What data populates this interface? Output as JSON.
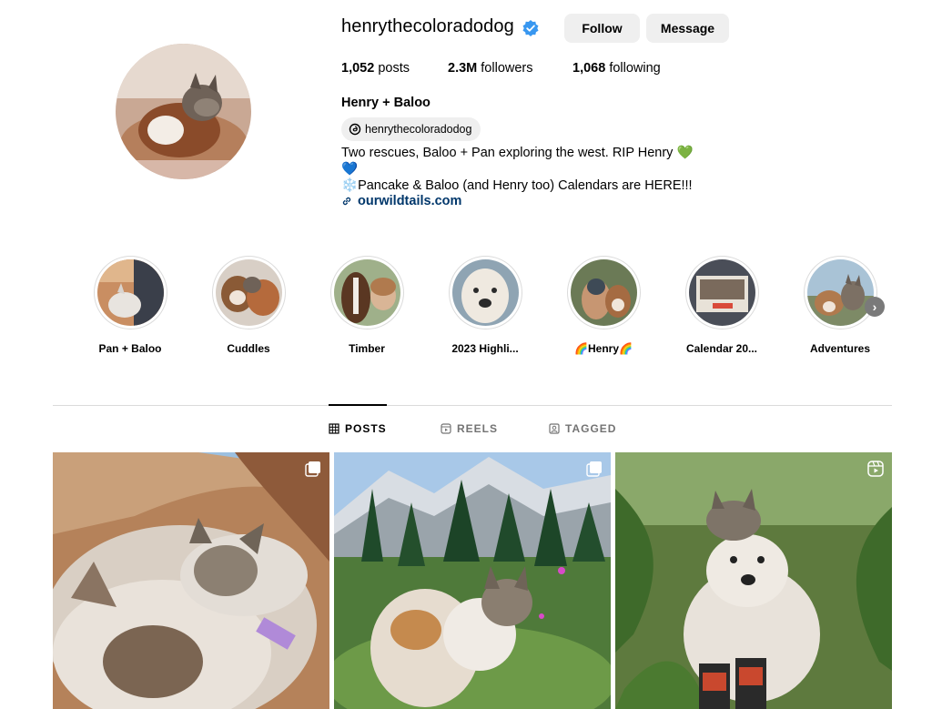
{
  "profile": {
    "username": "henrythecoloradodog",
    "verified": true,
    "follow_label": "Follow",
    "message_label": "Message",
    "stats": {
      "posts_count": "1,052",
      "posts_label": "posts",
      "followers_count": "2.3M",
      "followers_label": "followers",
      "following_count": "1,068",
      "following_label": "following"
    },
    "display_name": "Henry + Baloo",
    "threads_handle": "henrythecoloradodog",
    "bio": {
      "line1": "Two rescues, Baloo + Pan exploring the west. RIP Henry",
      "line1_emoji": "💚",
      "line2_emoji": "💙",
      "line3_emoji": "❄️",
      "line3": "Pancake & Baloo (and Henry too) Calendars are HERE!!!"
    },
    "link": "ourwildtails.com"
  },
  "highlights": [
    {
      "label": "Pan + Baloo"
    },
    {
      "label": "Cuddles"
    },
    {
      "label": "Timber"
    },
    {
      "label": "2023 Highli..."
    },
    {
      "label": "🌈Henry🌈"
    },
    {
      "label": "Calendar 20..."
    },
    {
      "label": "Adventures"
    }
  ],
  "tabs": {
    "posts": "POSTS",
    "reels": "REELS",
    "tagged": "TAGGED"
  },
  "posts": [
    {
      "type": "carousel",
      "badge_icon": "carousel-icon"
    },
    {
      "type": "carousel",
      "badge_icon": "carousel-icon"
    },
    {
      "type": "reel",
      "badge_icon": "reel-icon"
    }
  ],
  "colors": {
    "button_bg": "#efefef",
    "link": "#00376b",
    "verified": "#3897f0",
    "divider": "#dbdbdb",
    "tab_inactive": "#737373"
  }
}
